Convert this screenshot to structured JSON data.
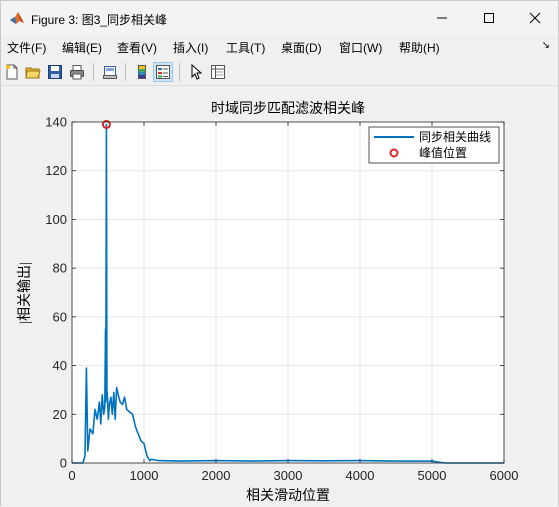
{
  "window": {
    "title": "Figure 3: 图3_同步相关峰"
  },
  "menu": [
    {
      "label": "文件(F)"
    },
    {
      "label": "编辑(E)"
    },
    {
      "label": "查看(V)"
    },
    {
      "label": "插入(I)"
    },
    {
      "label": "工具(T)"
    },
    {
      "label": "桌面(D)"
    },
    {
      "label": "窗口(W)"
    },
    {
      "label": "帮助(H)"
    }
  ],
  "toolbar": {
    "icons": [
      "new-file-icon",
      "open-folder-icon",
      "save-icon",
      "print-icon",
      "link-axes-icon",
      "colorbar-icon",
      "legend-icon",
      "pointer-icon",
      "property-inspector-icon"
    ]
  },
  "colors": {
    "line": "#0072BD",
    "marker": "#D62728",
    "grid": "#E5E5E5",
    "axis": "#262626"
  },
  "chart_data": {
    "type": "line",
    "title": "时域同步匹配滤波相关峰",
    "xlabel": "相关滑动位置",
    "ylabel": "|相关输出|",
    "xlim": [
      0,
      6000
    ],
    "ylim": [
      0,
      140
    ],
    "xticks": [
      "0",
      "1000",
      "2000",
      "3000",
      "4000",
      "5000",
      "6000"
    ],
    "yticks": [
      "0",
      "20",
      "40",
      "60",
      "80",
      "100",
      "120",
      "140"
    ],
    "grid": true,
    "legend_position": "top-right",
    "series": [
      {
        "name": "同步相关曲线",
        "style": "line",
        "x": [
          0,
          150,
          180,
          200,
          220,
          250,
          290,
          320,
          350,
          380,
          400,
          420,
          440,
          455,
          465,
          470,
          478,
          485,
          495,
          505,
          520,
          540,
          560,
          580,
          600,
          620,
          650,
          670,
          700,
          730,
          760,
          800,
          840,
          880,
          920,
          960,
          1000,
          1040,
          1080,
          1100,
          1200,
          1500,
          2000,
          2500,
          3000,
          3500,
          4000,
          4500,
          5000,
          5100,
          5200,
          6000
        ],
        "y": [
          0,
          0,
          3,
          39,
          5,
          14,
          12,
          22,
          18,
          25,
          16,
          28,
          20,
          23,
          55,
          25,
          139,
          30,
          26,
          18,
          24,
          27,
          20,
          29,
          18,
          31,
          27,
          25,
          24,
          27,
          22,
          21,
          20,
          15,
          12,
          9,
          8,
          3,
          1,
          1.5,
          1,
          0.8,
          1,
          0.8,
          1,
          0.9,
          1,
          0.8,
          0.8,
          0.3,
          0,
          0
        ]
      },
      {
        "name": "峰值位置",
        "style": "marker",
        "x": [
          478
        ],
        "y": [
          139
        ]
      }
    ]
  }
}
